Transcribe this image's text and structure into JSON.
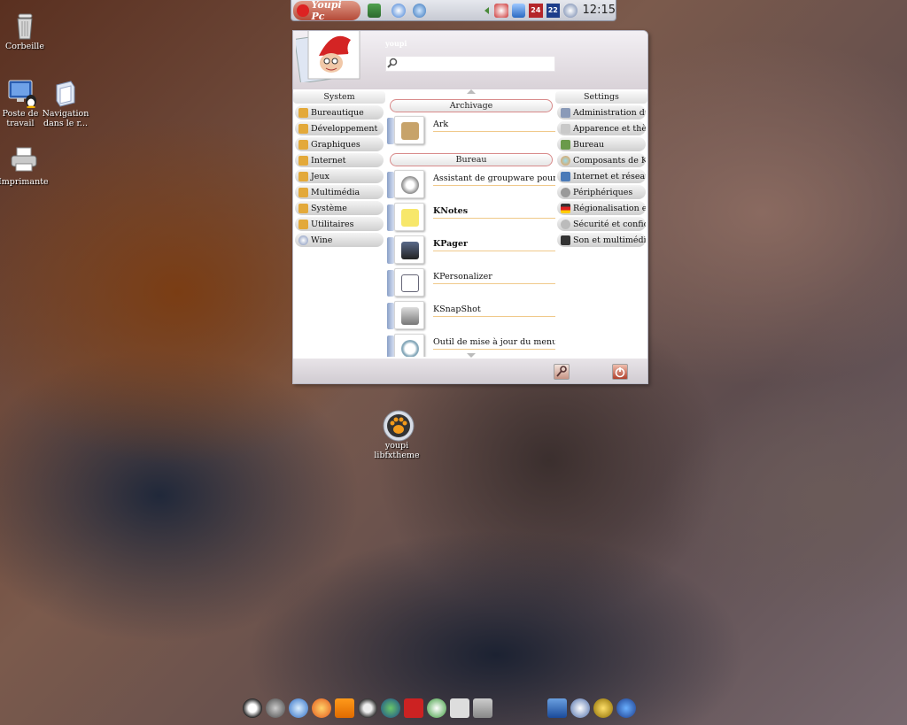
{
  "desktop": {
    "icons": [
      {
        "label": "Corbeille"
      },
      {
        "label": "Poste de travail"
      },
      {
        "label": "Navigation dans le r..."
      },
      {
        "label": "Imprimante"
      },
      {
        "label": "youpi libfxtheme"
      }
    ]
  },
  "panel": {
    "kmenu_label": "Youpi Pc",
    "pager_1": "24",
    "pager_2": "22",
    "clock": "12:15"
  },
  "menu": {
    "user": "youpi",
    "search": {
      "value": ""
    },
    "left_header": "System",
    "left_items": [
      {
        "label": "Bureautique",
        "icon": "folder-icon"
      },
      {
        "label": "Développement",
        "icon": "folder-icon"
      },
      {
        "label": "Graphiques",
        "icon": "folder-icon"
      },
      {
        "label": "Internet",
        "icon": "folder-icon"
      },
      {
        "label": "Jeux",
        "icon": "folder-icon"
      },
      {
        "label": "Multimédia",
        "icon": "folder-icon"
      },
      {
        "label": "Système",
        "icon": "folder-icon"
      },
      {
        "label": "Utilitaires",
        "icon": "folder-icon"
      },
      {
        "label": "Wine",
        "icon": "wine-icon"
      }
    ],
    "right_header": "Settings",
    "right_items": [
      {
        "label": "Administration du",
        "icon": "admin-icon"
      },
      {
        "label": "Apparence et thèm",
        "icon": "appearance-icon"
      },
      {
        "label": "Bureau",
        "icon": "desktop-icon"
      },
      {
        "label": "Composants de KD",
        "icon": "components-icon"
      },
      {
        "label": "Internet et réseau",
        "icon": "network-icon"
      },
      {
        "label": "Périphériques",
        "icon": "devices-icon"
      },
      {
        "label": "Régionalisation et a",
        "icon": "flag-icon"
      },
      {
        "label": "Sécurité et confide",
        "icon": "security-icon"
      },
      {
        "label": "Son et multimédia",
        "icon": "sound-icon"
      }
    ],
    "sections": [
      {
        "title": "Archivage",
        "apps": [
          {
            "label": "Ark",
            "bold": false
          }
        ]
      },
      {
        "title": "Bureau",
        "apps": [
          {
            "label": "Assistant de groupware pour...",
            "bold": false
          },
          {
            "label": "KNotes",
            "bold": true
          },
          {
            "label": "KPager",
            "bold": true
          },
          {
            "label": "KPersonalizer",
            "bold": false
          },
          {
            "label": "KSnapShot",
            "bold": false
          },
          {
            "label": "Outil de mise à jour du menu",
            "bold": false
          }
        ]
      }
    ]
  },
  "colors": {
    "accent": "#c0504d",
    "highlight_line": "#f0c98a"
  }
}
